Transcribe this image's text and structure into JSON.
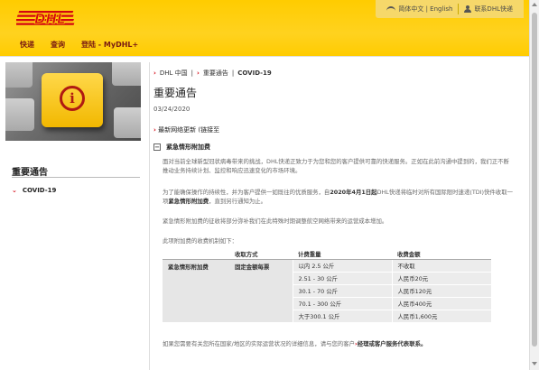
{
  "header": {
    "logo_text": "DHL",
    "util": {
      "language": "简体中文 | English",
      "contact": "联系DHL快递"
    },
    "nav": [
      "快递",
      "查询",
      "登陆 - MyDHL+"
    ]
  },
  "sidebar": {
    "title": "重要通告",
    "items": [
      {
        "label": "COVID-19"
      }
    ]
  },
  "breadcrumb": [
    "DHL 中国",
    "重要通告",
    "COVID-19"
  ],
  "main": {
    "title": "重要通告",
    "date": "03/24/2020",
    "update_link": "最新网络更新 (链接至",
    "section_title": "紧急情形附加费",
    "para1": "面对当前全球新型冠状病毒带来的挑战，DHL快递正致力于为您和您的客户提供可靠的快递服务。正如在此前沟通中提到的，我们正不断推动业务持续计划、监控和响应迅速变化的市场环境。",
    "para2_pre": "为了能确保操作的持续性，并为客户提供一如既往的优质服务，自",
    "para2_bold": "2020年4月1日起",
    "para2_post": "DHL快递将临时对所有国际限时速递(TDI)快件收取一项",
    "para2_bold2": "紧急情形附加费",
    "para2_end": "，直到另行通知为止。",
    "para3": "紧急情形附加费的征收将部分弥补我们在此特殊时期调整航空网络带来的运营成本增加。",
    "para4": "此项附加费的收费机制如下：",
    "footer_pre": "如果您需要有关您所在国家/地区的实际运营状况的详细信息，请与您的客户",
    "footer_link": "经理或客户服务代表联系。"
  },
  "table": {
    "headers": [
      "",
      "收取方式",
      "计费重量",
      "收费金额"
    ],
    "surcharge_name": "紧急情形附加费",
    "method": "固定金额每票",
    "rows": [
      {
        "weight": "以内 2.5 公斤",
        "amount": "不收取"
      },
      {
        "weight": "2.51 - 30 公斤",
        "amount": "人民币20元"
      },
      {
        "weight": "30.1 - 70 公斤",
        "amount": "人民币120元"
      },
      {
        "weight": "70.1 - 300 公斤",
        "amount": "人民币400元"
      },
      {
        "weight": "大于300.1 公斤",
        "amount": "人民币1,600元"
      }
    ]
  },
  "colors": {
    "brand_yellow": "#ffcc00",
    "brand_red": "#d40511",
    "nav_text": "#7a1b12"
  }
}
